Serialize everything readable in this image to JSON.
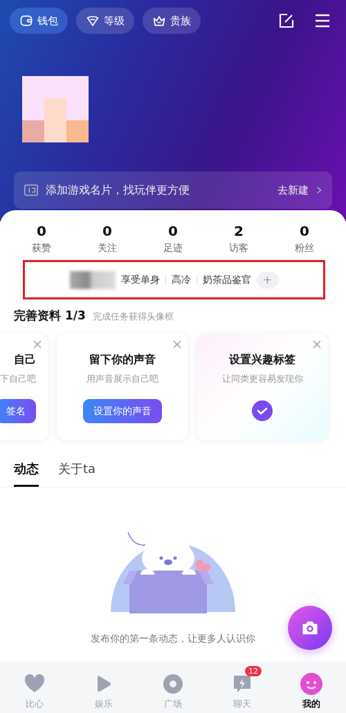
{
  "top_buttons": [
    {
      "kind": "wallet",
      "label": "钱包"
    },
    {
      "kind": "level",
      "label": "等级"
    },
    {
      "kind": "noble",
      "label": "贵族"
    }
  ],
  "banner": {
    "text": "添加游戏名片，找玩伴更方便",
    "action": "去新建"
  },
  "stats": [
    {
      "value": "0",
      "label": "获赞"
    },
    {
      "value": "0",
      "label": "关注"
    },
    {
      "value": "0",
      "label": "足迹"
    },
    {
      "value": "2",
      "label": "访客"
    },
    {
      "value": "0",
      "label": "粉丝"
    }
  ],
  "tags": [
    "享受单身",
    "高冷",
    "奶茶品鉴官"
  ],
  "add_tag": "+",
  "profile_tasks": {
    "title": "完善资料",
    "progress": "1/3",
    "hint": "完成任务获得头像框"
  },
  "task_cards": [
    {
      "title": "自己",
      "subtitle": "下自己吧",
      "action": "签名",
      "done": false
    },
    {
      "title": "留下你的声音",
      "subtitle": "用声音展示自己吧",
      "action": "设置你的声音",
      "done": false
    },
    {
      "title": "设置兴趣标签",
      "subtitle": "让同类更容易发现你",
      "done": true
    }
  ],
  "tabs": [
    {
      "label": "动态",
      "selected": true
    },
    {
      "label": "关于ta",
      "selected": false
    }
  ],
  "empty_text": "发布你的第一条动态，让更多人认识你",
  "nav": [
    {
      "kind": "heart",
      "label": "比心",
      "selected": false
    },
    {
      "kind": "play",
      "label": "娱乐",
      "selected": false
    },
    {
      "kind": "disc",
      "label": "广场",
      "selected": false
    },
    {
      "kind": "chat",
      "label": "聊天",
      "selected": false,
      "badge": "12"
    },
    {
      "kind": "avatar",
      "label": "我的",
      "selected": true
    }
  ]
}
